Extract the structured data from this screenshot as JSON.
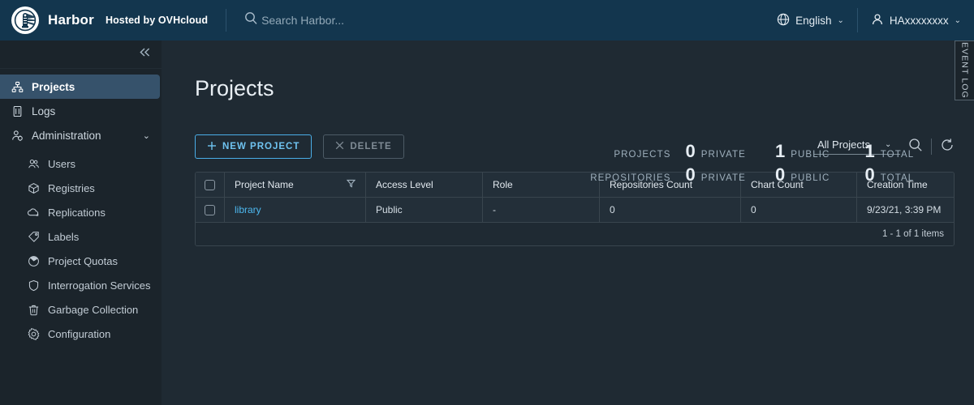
{
  "header": {
    "logo_icon": "harbor-lighthouse-logo",
    "brand": "Harbor",
    "hosted_by": "Hosted by OVHcloud",
    "search": {
      "icon": "search-icon",
      "placeholder": "Search Harbor..."
    },
    "language": {
      "icon": "globe-icon",
      "label": "English",
      "caret": "⌄"
    },
    "user": {
      "icon": "user-icon",
      "label": "HAxxxxxxxx",
      "caret": "⌄"
    }
  },
  "event_log": {
    "label": "EVENT LOG"
  },
  "sidebar": {
    "collapse_icon": "double-chevron-left-icon",
    "items": [
      {
        "label": "Projects",
        "icon": "projects-icon",
        "active": true
      },
      {
        "label": "Logs",
        "icon": "logs-icon",
        "active": false
      },
      {
        "label": "Administration",
        "icon": "administration-icon",
        "expand_caret": "⌄",
        "active": false
      },
      {
        "label": "Users",
        "icon": "users-icon",
        "sub": true
      },
      {
        "label": "Registries",
        "icon": "registries-icon",
        "sub": true
      },
      {
        "label": "Replications",
        "icon": "replications-icon",
        "sub": true
      },
      {
        "label": "Labels",
        "icon": "labels-icon",
        "sub": true
      },
      {
        "label": "Project Quotas",
        "icon": "project-quotas-icon",
        "sub": true
      },
      {
        "label": "Interrogation Services",
        "icon": "interrogation-services-icon",
        "sub": true
      },
      {
        "label": "Garbage Collection",
        "icon": "garbage-collection-icon",
        "sub": true
      },
      {
        "label": "Configuration",
        "icon": "configuration-icon",
        "sub": true
      }
    ]
  },
  "main": {
    "title": "Projects",
    "stats": [
      {
        "label": "PROJECTS",
        "cells": [
          {
            "value": "0",
            "unit": "PRIVATE"
          },
          {
            "value": "1",
            "unit": "PUBLIC"
          },
          {
            "value": "1",
            "unit": "TOTAL"
          }
        ]
      },
      {
        "label": "REPOSITORIES",
        "cells": [
          {
            "value": "0",
            "unit": "PRIVATE"
          },
          {
            "value": "0",
            "unit": "PUBLIC"
          },
          {
            "value": "0",
            "unit": "TOTAL"
          }
        ]
      }
    ],
    "toolbar": {
      "new_project": "NEW PROJECT",
      "new_project_icon": "plus-icon",
      "delete": "DELETE",
      "delete_icon": "close-x-icon",
      "filter_value": "All Projects",
      "filter_caret": "⌄",
      "search_icon": "search-icon",
      "refresh_icon": "refresh-icon"
    },
    "table": {
      "columns": [
        "Project Name",
        "Access Level",
        "Role",
        "Repositories Count",
        "Chart Count",
        "Creation Time"
      ],
      "filter_icon": "funnel-filter-icon",
      "rows": [
        {
          "name": "library",
          "access_level": "Public",
          "role": "-",
          "repositories_count": "0",
          "chart_count": "0",
          "creation_time": "9/23/21, 3:39 PM"
        }
      ],
      "footer": "1 - 1 of 1 items"
    }
  }
}
